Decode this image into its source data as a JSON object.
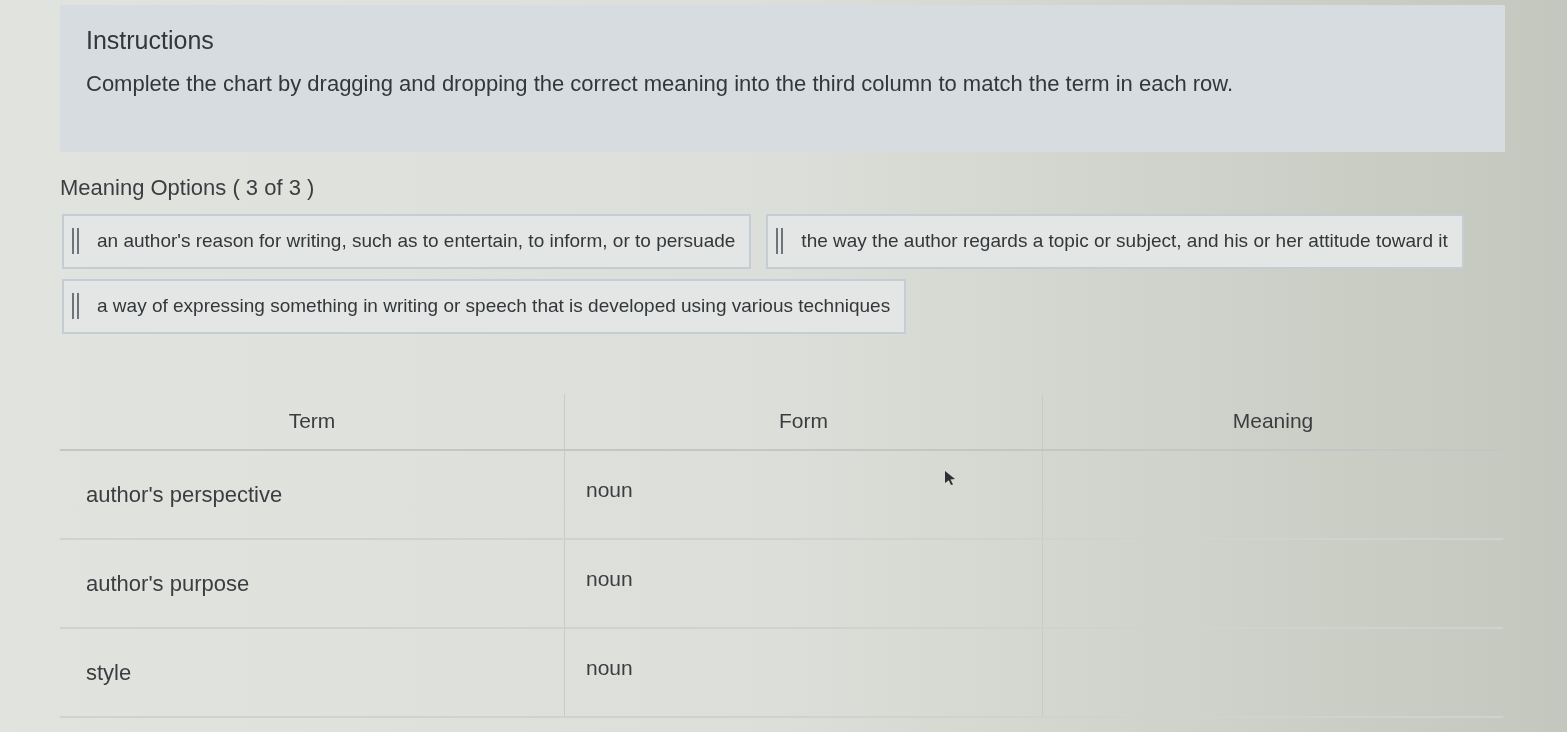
{
  "instructions": {
    "title": "Instructions",
    "text": "Complete the chart by dragging and dropping the correct meaning into the third column to match the term in each row."
  },
  "meaning_options": {
    "heading": "Meaning Options ( 3 of 3 )",
    "options": [
      "an author's reason for writing, such as to entertain, to inform, or to persuade",
      "the way the author regards a topic or subject, and his or her attitude toward it",
      "a way of expressing something in writing or speech that is developed using various techniques"
    ]
  },
  "table": {
    "columns": [
      "Term",
      "Form",
      "Meaning"
    ],
    "rows": [
      {
        "term": "author's perspective",
        "form": "noun"
      },
      {
        "term": "author's purpose",
        "form": "noun"
      },
      {
        "term": "style",
        "form": "noun"
      }
    ]
  }
}
